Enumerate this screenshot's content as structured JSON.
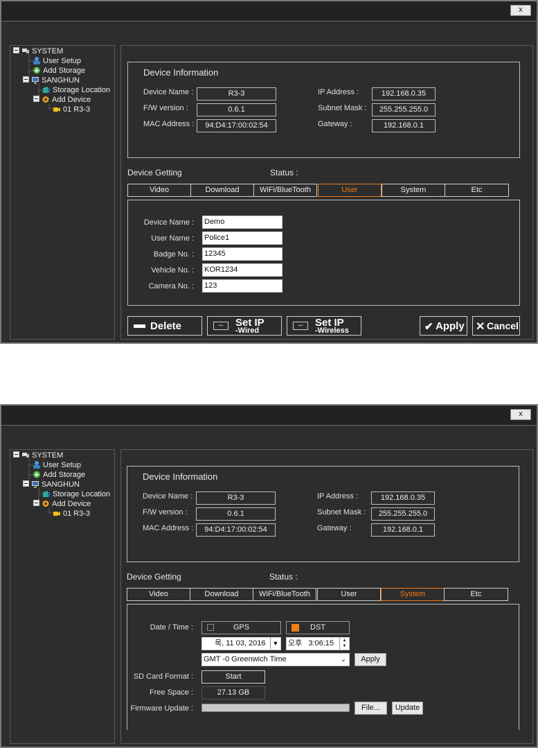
{
  "window1": {
    "close_label": "x",
    "tree": {
      "system": "SYSTEM",
      "user_setup": "User Setup",
      "add_storage": "Add Storage",
      "sanghun": "SANGHUN",
      "storage_location": "Storage Location",
      "add_device": "Add Device",
      "device": "01 R3-3"
    },
    "device_info": {
      "title": "Device Information",
      "device_name_label": "Device Name :",
      "device_name": "R3-3",
      "fw_label": "F/W version :",
      "fw": "0.6.1",
      "mac_label": "MAC Address :",
      "mac": "94:D4:17:00:02:54",
      "ip_label": "IP Address :",
      "ip": "192.168.0.35",
      "subnet_label": "Subnet Mask :",
      "subnet": "255.255.255.0",
      "gateway_label": "Gateway :",
      "gateway": "192.168.0.1"
    },
    "device_getting_label": "Device Getting",
    "status_label": "Status :",
    "tabs": [
      "Video",
      "Download",
      "WiFi/BlueTooth",
      "User",
      "System",
      "Etc"
    ],
    "active_tab": "User",
    "user": {
      "device_name_label": "Device Name :",
      "device_name": "Demo",
      "user_name_label": "User Name :",
      "user_name": "Police1",
      "badge_label": "Badge No. :",
      "badge": "12345",
      "vehicle_label": "Vehicle No. :",
      "vehicle": "KOR1234",
      "camera_label": "Camera No. :",
      "camera": "123"
    },
    "buttons": {
      "delete": "Delete",
      "set_ip": "Set IP",
      "wired": "-Wired",
      "wireless": "-Wireless",
      "apply": "Apply",
      "cancel": "Cancel"
    }
  },
  "window2": {
    "close_label": "x",
    "tree": {
      "system": "SYSTEM",
      "user_setup": "User Setup",
      "add_storage": "Add Storage",
      "sanghun": "SANGHUN",
      "storage_location": "Storage Location",
      "add_device": "Add Device",
      "device": "01 R3-3"
    },
    "device_info": {
      "title": "Device Information",
      "device_name_label": "Device Name :",
      "device_name": "R3-3",
      "fw_label": "F/W version :",
      "fw": "0.6.1",
      "mac_label": "MAC Address :",
      "mac": "94:D4:17:00:02:54",
      "ip_label": "IP Address :",
      "ip": "192.168.0.35",
      "subnet_label": "Subnet Mask :",
      "subnet": "255.255.255.0",
      "gateway_label": "Gateway :",
      "gateway": "192.168.0.1"
    },
    "device_getting_label": "Device Getting",
    "status_label": "Status :",
    "tabs": [
      "Video",
      "Download",
      "WiFi/BlueTooth",
      "User",
      "System",
      "Etc"
    ],
    "active_tab": "System",
    "system": {
      "datetime_label": "Date / Time :",
      "gps_label": "GPS",
      "gps_checked": false,
      "dst_label": "DST",
      "dst_checked": true,
      "date_value": "목, 11 03, 2016",
      "ampm": "오후",
      "time_value": "3:06:15",
      "timezone": "GMT -0 Greenwich Time",
      "apply_label": "Apply",
      "sd_format_label": "SD Card Format :",
      "start_label": "Start",
      "free_space_label": "Free Space :",
      "free_space": "27.13 GB",
      "firmware_label": "Firmware Update :",
      "firmware_progress": 0,
      "file_label": "File...",
      "update_label": "Update"
    }
  },
  "colors": {
    "background": "#2d2d2d",
    "accent": "#ef7d1a",
    "border": "#bdbdbd"
  }
}
